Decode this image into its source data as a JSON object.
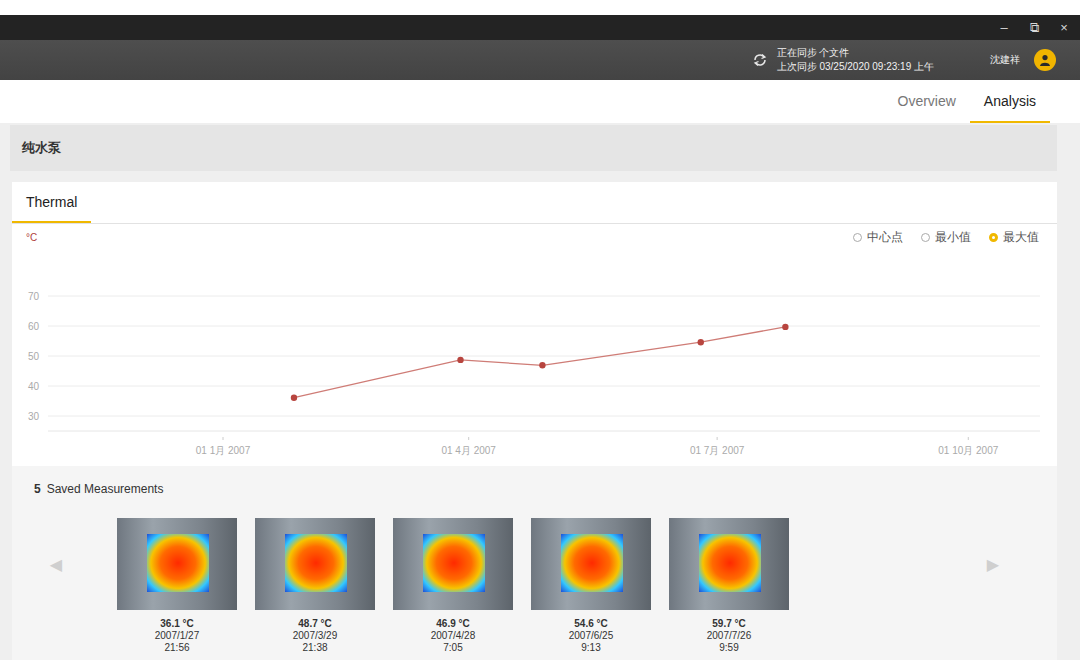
{
  "window": {
    "controls": [
      "–",
      "⧉",
      "×"
    ]
  },
  "sync": {
    "status": "正在同步 个文件",
    "last_sync": "上次同步 03/25/2020 09:23:19 上午"
  },
  "user": {
    "name": "沈建祥"
  },
  "nav_tabs": [
    {
      "label": "Overview",
      "selected": false
    },
    {
      "label": "Analysis",
      "selected": true
    }
  ],
  "asset": {
    "name": "纯水泵"
  },
  "panel_tabs": [
    {
      "label": "Thermal",
      "selected": true
    }
  ],
  "chart": {
    "unit": "°C",
    "modes": [
      {
        "label": "中心点",
        "selected": false
      },
      {
        "label": "最小值",
        "selected": false
      },
      {
        "label": "最大值",
        "selected": true
      }
    ],
    "y_ticks": [
      "70",
      "60",
      "50",
      "40",
      "30"
    ],
    "x_ticks": [
      {
        "label": "01 1月 2007",
        "day": 0
      },
      {
        "label": "01 4月 2007",
        "day": 90
      },
      {
        "label": "01 7月 2007",
        "day": 181
      },
      {
        "label": "01 10月 2007",
        "day": 273
      }
    ],
    "series": [
      {
        "values": [
          36.1,
          48.7,
          46.9,
          54.6,
          59.7
        ],
        "days": [
          26,
          87,
          117,
          175,
          206
        ]
      }
    ]
  },
  "measurements": {
    "count": "5",
    "title": "Saved Measurements",
    "nav": [
      "◀",
      "▶"
    ],
    "items": [
      {
        "temp": "36.1 °C",
        "date": "2007/1/27",
        "time": "21:56"
      },
      {
        "temp": "48.7 °C",
        "date": "2007/3/29",
        "time": "21:38"
      },
      {
        "temp": "46.9 °C",
        "date": "2007/4/28",
        "time": "7:05"
      },
      {
        "temp": "54.6 °C",
        "date": "2007/6/25",
        "time": "9:13"
      },
      {
        "temp": "59.7 °C",
        "date": "2007/7/26",
        "time": "9:59"
      }
    ]
  }
}
